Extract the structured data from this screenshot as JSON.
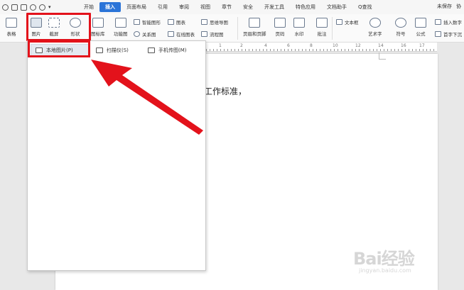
{
  "menubar": {
    "tabs": [
      "开始",
      "插入",
      "页面布局",
      "引用",
      "审阅",
      "视图",
      "章节",
      "安全",
      "开发工具",
      "特色应用",
      "文档助手",
      "Q查找"
    ],
    "active_tab": "插入",
    "save_status": "未保存",
    "right_extra": "协"
  },
  "ribbon": {
    "table": "表格",
    "picture": "图片",
    "screenshot": "截屏",
    "shape": "形状",
    "icon_lib": "图标库",
    "func_chart": "功能图",
    "smart_graphic": "智能图形",
    "chart": "图表",
    "relation_chart": "关系图",
    "online_chart": "在线图表",
    "mindmap": "思维导图",
    "flowchart": "流程图",
    "header_footer": "页眉和页脚",
    "page_number": "页码",
    "watermark": "水印",
    "comment": "批注",
    "textbox": "文本框",
    "art_text": "艺术字",
    "symbol": "符号",
    "formula": "公式",
    "insert_number": "插入数字",
    "drop_cap": "首字下沉"
  },
  "dropdown": {
    "items": [
      {
        "label": "本地图片(P)"
      },
      {
        "label": "扫描仪(S)"
      },
      {
        "label": "手机传图(M)"
      }
    ]
  },
  "ruler": {
    "numbers": [
      "1",
      "2",
      "4",
      "6",
      "8",
      "10",
      "12",
      "14",
      "16",
      "17"
    ]
  },
  "document": {
    "text": "工作标准，"
  },
  "watermark": {
    "logo": "Bai经验",
    "sub": "jingyan.baidu.com"
  },
  "colors": {
    "accent": "#2b74d8",
    "highlight": "#e3121b"
  }
}
